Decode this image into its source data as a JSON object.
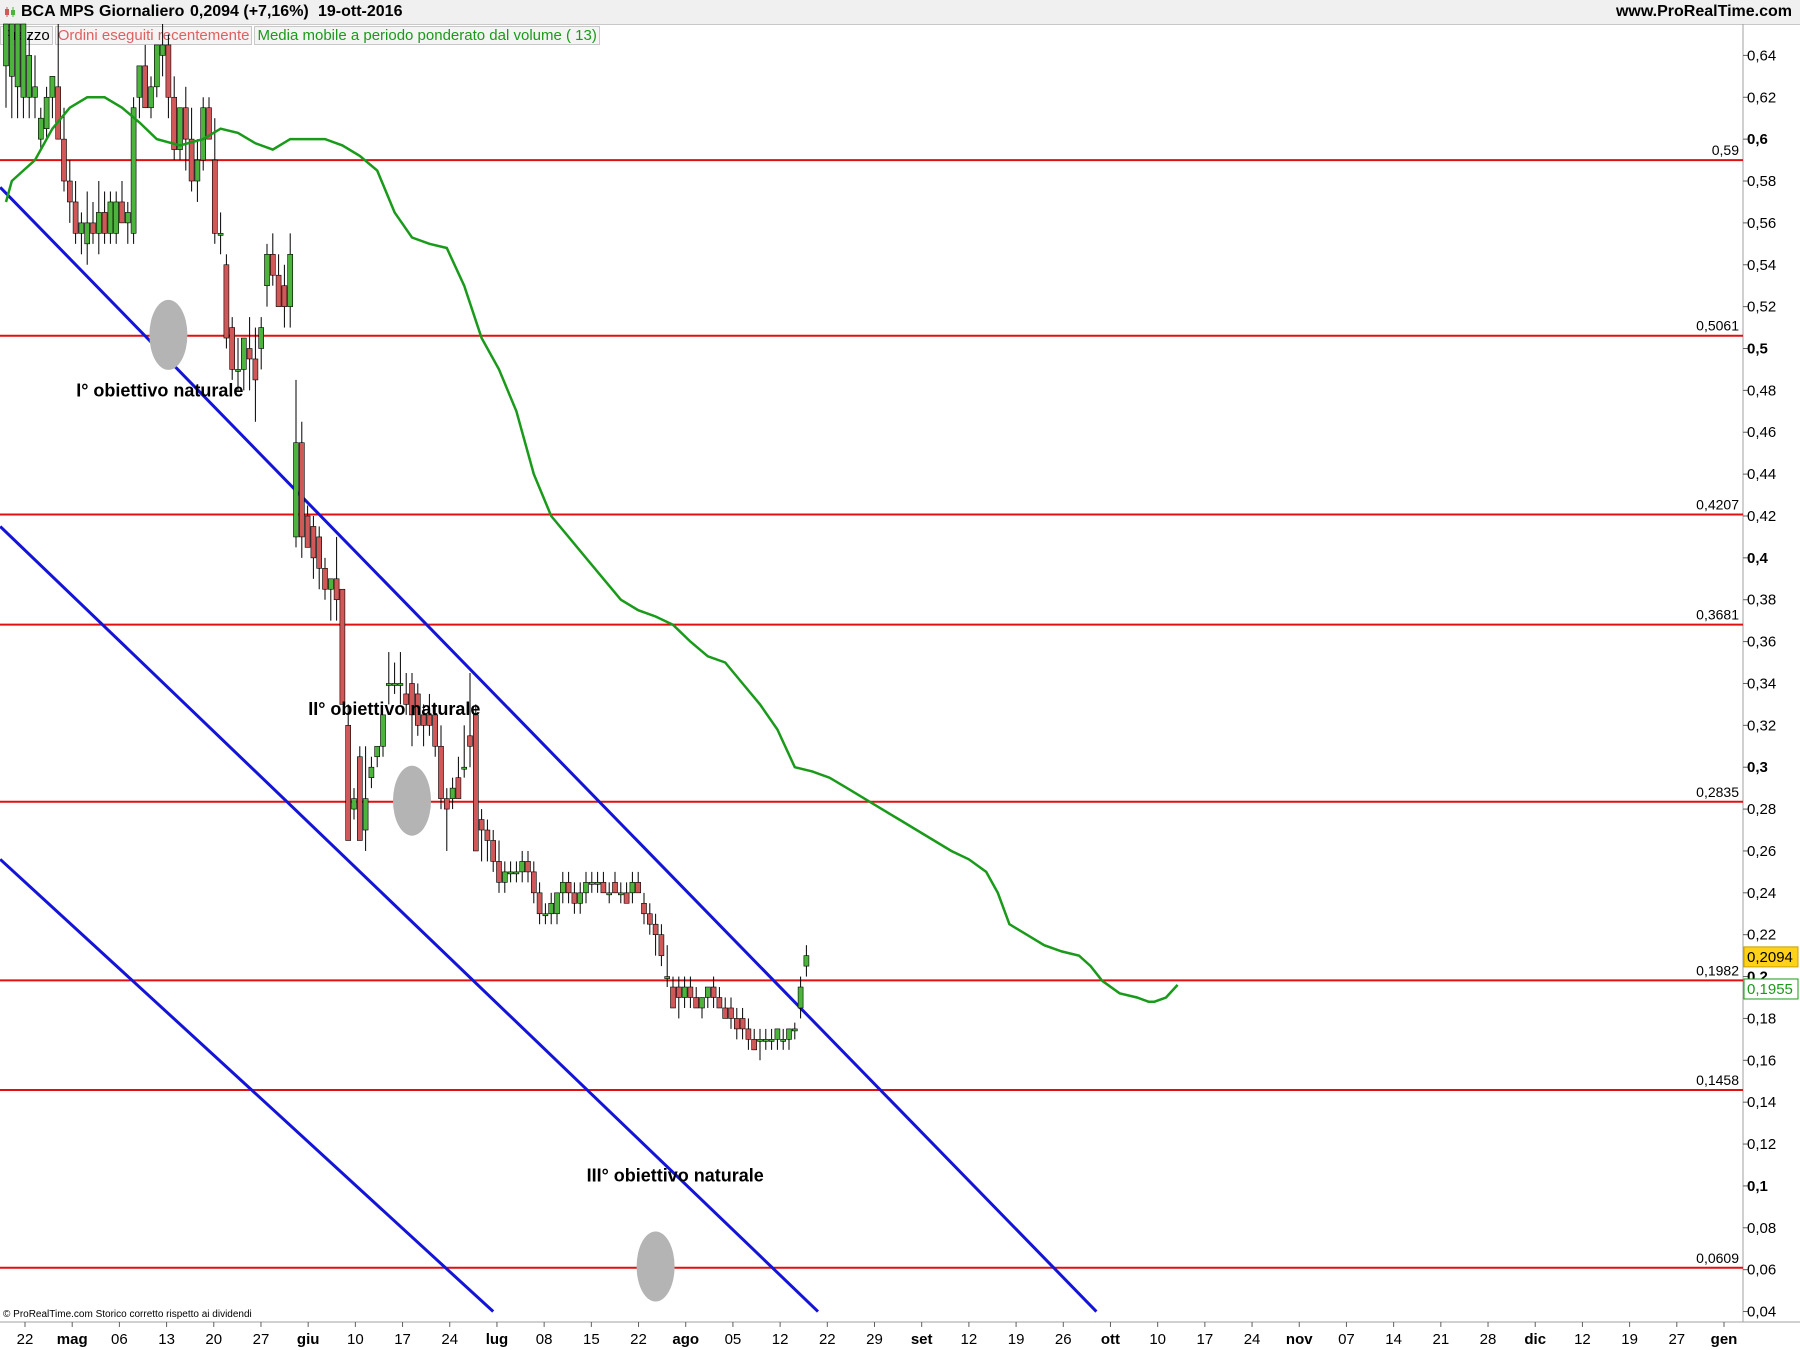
{
  "header": {
    "symbol": "BCA MPS",
    "period": "Giornaliero",
    "price": "0,2094 (+7,16%)",
    "date": "19-ott-2016",
    "site": "www.ProRealTime.com"
  },
  "legend": {
    "price_label": "Prezzo",
    "orders_label": "Ordini eseguiti recentemente",
    "ma_label": "Media mobile a periodo ponderato dal volume ( 13)"
  },
  "footer": "© ProRealTime.com  Storico corretto rispetto ai dividendi",
  "colors": {
    "up": "#4cb43c",
    "down": "#d05858",
    "ma": "#1a9a1a",
    "trend": "#1414d8",
    "level": "#e01010",
    "orders_text": "#e06060"
  },
  "chart_data": {
    "type": "candlestick",
    "ylim": [
      0.035,
      0.655
    ],
    "y_ticks": [
      "0,64",
      "0,62",
      "0,6",
      "0,58",
      "0,56",
      "0,54",
      "0,52",
      "0,5",
      "0,48",
      "0,46",
      "0,44",
      "0,42",
      "0,4",
      "0,38",
      "0,36",
      "0,34",
      "0,32",
      "0,3",
      "0,28",
      "0,26",
      "0,24",
      "0,22",
      "0,2",
      "0,18",
      "0,16",
      "0,14",
      "0,12",
      "0,1",
      "0,08",
      "0,06",
      "0,04"
    ],
    "x_labels": [
      "22",
      "mag",
      "06",
      "13",
      "20",
      "27",
      "giu",
      "10",
      "17",
      "24",
      "lug",
      "08",
      "15",
      "22",
      "ago",
      "05",
      "12",
      "22",
      "29",
      "set",
      "12",
      "19",
      "26",
      "ott",
      "10",
      "17",
      "24",
      "nov",
      "07",
      "14",
      "21",
      "28",
      "dic",
      "12",
      "19",
      "27",
      "gen"
    ],
    "horizontal_levels": [
      {
        "value": 0.59,
        "label": "0,59"
      },
      {
        "value": 0.5061,
        "label": "0,5061"
      },
      {
        "value": 0.4207,
        "label": "0,4207"
      },
      {
        "value": 0.3681,
        "label": "0,3681"
      },
      {
        "value": 0.2835,
        "label": "0,2835"
      },
      {
        "value": 0.1982,
        "label": "0,1982"
      },
      {
        "value": 0.1458,
        "label": "0,1458"
      },
      {
        "value": 0.0609,
        "label": "0,0609"
      }
    ],
    "last_price": {
      "value": 0.2094,
      "label": "0,2094"
    },
    "ma_value": {
      "value": 0.1955,
      "label": "0,1955"
    },
    "annotations": [
      {
        "text": "I° obiettivo naturale",
        "day": 19,
        "value": 0.477
      },
      {
        "text": "II° obiettivo naturale",
        "day": 59,
        "value": 0.325
      },
      {
        "text": "III° obiettivo naturale",
        "day": 107,
        "value": 0.102
      }
    ],
    "ovals": [
      {
        "day": 28,
        "value": 0.5065
      },
      {
        "day": 70,
        "value": 0.284
      },
      {
        "day": 112,
        "value": 0.0615
      }
    ],
    "trendlines": [
      {
        "from": [
          -1,
          0.577
        ],
        "to": [
          188,
          0.04
        ]
      },
      {
        "from": [
          -1,
          0.415
        ],
        "to": [
          140,
          0.04
        ]
      },
      {
        "from": [
          -1,
          0.256
        ],
        "to": [
          84,
          0.04
        ]
      }
    ],
    "candles": [
      [
        0.635,
        0.655,
        0.615,
        0.655
      ],
      [
        0.63,
        0.655,
        0.61,
        0.655
      ],
      [
        0.625,
        0.655,
        0.61,
        0.655
      ],
      [
        0.62,
        0.655,
        0.61,
        0.655
      ],
      [
        0.62,
        0.65,
        0.61,
        0.64
      ],
      [
        0.62,
        0.64,
        0.61,
        0.625
      ],
      [
        0.6,
        0.615,
        0.595,
        0.61
      ],
      [
        0.605,
        0.625,
        0.6,
        0.62
      ],
      [
        0.62,
        0.63,
        0.61,
        0.63
      ],
      [
        0.625,
        0.655,
        0.6,
        0.6
      ],
      [
        0.6,
        0.615,
        0.575,
        0.58
      ],
      [
        0.58,
        0.59,
        0.56,
        0.57
      ],
      [
        0.57,
        0.58,
        0.55,
        0.555
      ],
      [
        0.555,
        0.565,
        0.545,
        0.56
      ],
      [
        0.55,
        0.575,
        0.54,
        0.56
      ],
      [
        0.56,
        0.57,
        0.55,
        0.555
      ],
      [
        0.555,
        0.58,
        0.545,
        0.565
      ],
      [
        0.565,
        0.575,
        0.55,
        0.555
      ],
      [
        0.555,
        0.575,
        0.55,
        0.57
      ],
      [
        0.555,
        0.575,
        0.55,
        0.57
      ],
      [
        0.57,
        0.58,
        0.56,
        0.56
      ],
      [
        0.56,
        0.57,
        0.55,
        0.565
      ],
      [
        0.555,
        0.62,
        0.55,
        0.615
      ],
      [
        0.62,
        0.63,
        0.61,
        0.635
      ],
      [
        0.635,
        0.645,
        0.615,
        0.615
      ],
      [
        0.615,
        0.63,
        0.61,
        0.625
      ],
      [
        0.625,
        0.64,
        0.62,
        0.645
      ],
      [
        0.64,
        0.655,
        0.63,
        0.645
      ],
      [
        0.645,
        0.65,
        0.61,
        0.62
      ],
      [
        0.62,
        0.63,
        0.59,
        0.595
      ],
      [
        0.595,
        0.61,
        0.59,
        0.615
      ],
      [
        0.615,
        0.625,
        0.585,
        0.6
      ],
      [
        0.6,
        0.615,
        0.575,
        0.58
      ],
      [
        0.58,
        0.6,
        0.57,
        0.59
      ],
      [
        0.59,
        0.62,
        0.585,
        0.615
      ],
      [
        0.615,
        0.62,
        0.6,
        0.6
      ],
      [
        0.59,
        0.61,
        0.55,
        0.555
      ],
      [
        0.555,
        0.565,
        0.545,
        0.555
      ],
      [
        0.54,
        0.545,
        0.5,
        0.505
      ],
      [
        0.51,
        0.515,
        0.485,
        0.49
      ],
      [
        0.49,
        0.505,
        0.48,
        0.49
      ],
      [
        0.49,
        0.505,
        0.48,
        0.505
      ],
      [
        0.5,
        0.515,
        0.48,
        0.495
      ],
      [
        0.495,
        0.51,
        0.465,
        0.485
      ],
      [
        0.5,
        0.515,
        0.49,
        0.51
      ],
      [
        0.53,
        0.55,
        0.52,
        0.545
      ],
      [
        0.545,
        0.555,
        0.53,
        0.535
      ],
      [
        0.535,
        0.545,
        0.52,
        0.52
      ],
      [
        0.53,
        0.54,
        0.51,
        0.52
      ],
      [
        0.52,
        0.555,
        0.51,
        0.545
      ],
      [
        0.41,
        0.485,
        0.405,
        0.455
      ],
      [
        0.455,
        0.465,
        0.4,
        0.41
      ],
      [
        0.42,
        0.425,
        0.405,
        0.405
      ],
      [
        0.415,
        0.42,
        0.39,
        0.4
      ],
      [
        0.41,
        0.415,
        0.385,
        0.395
      ],
      [
        0.395,
        0.4,
        0.38,
        0.385
      ],
      [
        0.385,
        0.39,
        0.37,
        0.39
      ],
      [
        0.39,
        0.41,
        0.37,
        0.38
      ],
      [
        0.385,
        0.385,
        0.33,
        0.33
      ],
      [
        0.32,
        0.33,
        0.28,
        0.265
      ],
      [
        0.28,
        0.29,
        0.275,
        0.285
      ],
      [
        0.305,
        0.31,
        0.265,
        0.265
      ],
      [
        0.27,
        0.31,
        0.26,
        0.285
      ],
      [
        0.295,
        0.305,
        0.29,
        0.3
      ],
      [
        0.305,
        0.31,
        0.3,
        0.31
      ],
      [
        0.31,
        0.325,
        0.305,
        0.325
      ],
      [
        0.34,
        0.355,
        0.33,
        0.34
      ],
      [
        0.34,
        0.35,
        0.335,
        0.34
      ],
      [
        0.34,
        0.355,
        0.33,
        0.34
      ],
      [
        0.335,
        0.345,
        0.325,
        0.33
      ],
      [
        0.34,
        0.345,
        0.31,
        0.325
      ],
      [
        0.335,
        0.34,
        0.315,
        0.32
      ],
      [
        0.325,
        0.33,
        0.31,
        0.32
      ],
      [
        0.325,
        0.335,
        0.315,
        0.32
      ],
      [
        0.325,
        0.33,
        0.305,
        0.31
      ],
      [
        0.31,
        0.32,
        0.28,
        0.285
      ],
      [
        0.285,
        0.29,
        0.26,
        0.28
      ],
      [
        0.285,
        0.295,
        0.28,
        0.29
      ],
      [
        0.295,
        0.305,
        0.285,
        0.285
      ],
      [
        0.3,
        0.32,
        0.295,
        0.3
      ],
      [
        0.315,
        0.345,
        0.3,
        0.31
      ],
      [
        0.325,
        0.33,
        0.26,
        0.26
      ],
      [
        0.275,
        0.28,
        0.255,
        0.27
      ],
      [
        0.27,
        0.275,
        0.255,
        0.265
      ],
      [
        0.265,
        0.27,
        0.25,
        0.255
      ],
      [
        0.255,
        0.265,
        0.24,
        0.245
      ],
      [
        0.245,
        0.255,
        0.24,
        0.25
      ],
      [
        0.25,
        0.255,
        0.245,
        0.25
      ],
      [
        0.25,
        0.255,
        0.245,
        0.25
      ],
      [
        0.25,
        0.26,
        0.245,
        0.255
      ],
      [
        0.255,
        0.26,
        0.245,
        0.25
      ],
      [
        0.25,
        0.255,
        0.235,
        0.24
      ],
      [
        0.24,
        0.245,
        0.225,
        0.23
      ],
      [
        0.23,
        0.235,
        0.225,
        0.23
      ],
      [
        0.23,
        0.24,
        0.225,
        0.235
      ],
      [
        0.23,
        0.24,
        0.225,
        0.24
      ],
      [
        0.24,
        0.25,
        0.235,
        0.245
      ],
      [
        0.245,
        0.25,
        0.235,
        0.24
      ],
      [
        0.24,
        0.245,
        0.23,
        0.235
      ],
      [
        0.235,
        0.245,
        0.23,
        0.24
      ],
      [
        0.24,
        0.25,
        0.235,
        0.245
      ],
      [
        0.245,
        0.25,
        0.24,
        0.245
      ],
      [
        0.245,
        0.25,
        0.24,
        0.245
      ],
      [
        0.245,
        0.25,
        0.24,
        0.24
      ],
      [
        0.24,
        0.245,
        0.235,
        0.24
      ],
      [
        0.245,
        0.25,
        0.24,
        0.24
      ],
      [
        0.24,
        0.245,
        0.235,
        0.24
      ],
      [
        0.24,
        0.245,
        0.235,
        0.235
      ],
      [
        0.24,
        0.25,
        0.235,
        0.245
      ],
      [
        0.245,
        0.25,
        0.24,
        0.24
      ],
      [
        0.235,
        0.24,
        0.225,
        0.23
      ],
      [
        0.23,
        0.235,
        0.22,
        0.225
      ],
      [
        0.225,
        0.23,
        0.21,
        0.22
      ],
      [
        0.22,
        0.225,
        0.205,
        0.21
      ],
      [
        0.2,
        0.215,
        0.195,
        0.2
      ],
      [
        0.195,
        0.2,
        0.185,
        0.185
      ],
      [
        0.195,
        0.2,
        0.18,
        0.19
      ],
      [
        0.19,
        0.2,
        0.185,
        0.195
      ],
      [
        0.195,
        0.2,
        0.185,
        0.19
      ],
      [
        0.19,
        0.195,
        0.185,
        0.185
      ],
      [
        0.185,
        0.19,
        0.18,
        0.19
      ],
      [
        0.19,
        0.195,
        0.185,
        0.195
      ],
      [
        0.195,
        0.2,
        0.185,
        0.19
      ],
      [
        0.19,
        0.195,
        0.185,
        0.185
      ],
      [
        0.185,
        0.19,
        0.18,
        0.18
      ],
      [
        0.185,
        0.19,
        0.175,
        0.18
      ],
      [
        0.18,
        0.185,
        0.17,
        0.175
      ],
      [
        0.18,
        0.185,
        0.17,
        0.175
      ],
      [
        0.175,
        0.18,
        0.165,
        0.17
      ],
      [
        0.17,
        0.175,
        0.165,
        0.165
      ],
      [
        0.17,
        0.175,
        0.16,
        0.17
      ],
      [
        0.17,
        0.175,
        0.165,
        0.17
      ],
      [
        0.17,
        0.175,
        0.165,
        0.17
      ],
      [
        0.17,
        0.175,
        0.165,
        0.175
      ],
      [
        0.17,
        0.175,
        0.165,
        0.17
      ],
      [
        0.17,
        0.175,
        0.165,
        0.175
      ],
      [
        0.175,
        0.178,
        0.17,
        0.175
      ],
      [
        0.185,
        0.2,
        0.18,
        0.195
      ],
      [
        0.205,
        0.215,
        0.2,
        0.21
      ]
    ],
    "ma": [
      [
        0,
        0.57
      ],
      [
        1,
        0.58
      ],
      [
        3,
        0.585
      ],
      [
        5,
        0.59
      ],
      [
        8,
        0.605
      ],
      [
        11,
        0.615
      ],
      [
        14,
        0.62
      ],
      [
        17,
        0.62
      ],
      [
        20,
        0.615
      ],
      [
        23,
        0.608
      ],
      [
        26,
        0.6
      ],
      [
        30,
        0.597
      ],
      [
        34,
        0.6
      ],
      [
        37,
        0.605
      ],
      [
        40,
        0.603
      ],
      [
        43,
        0.598
      ],
      [
        46,
        0.595
      ],
      [
        49,
        0.6
      ],
      [
        52,
        0.6
      ],
      [
        55,
        0.6
      ],
      [
        58,
        0.597
      ],
      [
        61,
        0.592
      ],
      [
        64,
        0.585
      ],
      [
        67,
        0.565
      ],
      [
        70,
        0.553
      ],
      [
        73,
        0.55
      ],
      [
        76,
        0.548
      ],
      [
        79,
        0.53
      ],
      [
        82,
        0.505
      ],
      [
        85,
        0.49
      ],
      [
        88,
        0.47
      ],
      [
        91,
        0.44
      ],
      [
        94,
        0.42
      ],
      [
        97,
        0.41
      ],
      [
        100,
        0.4
      ],
      [
        103,
        0.39
      ],
      [
        106,
        0.38
      ],
      [
        109,
        0.375
      ],
      [
        112,
        0.372
      ],
      [
        115,
        0.368
      ],
      [
        118,
        0.36
      ],
      [
        121,
        0.353
      ],
      [
        124,
        0.35
      ],
      [
        127,
        0.34
      ],
      [
        130,
        0.33
      ],
      [
        133,
        0.318
      ],
      [
        136,
        0.3
      ],
      [
        139,
        0.298
      ],
      [
        142,
        0.295
      ],
      [
        145,
        0.29
      ],
      [
        148,
        0.285
      ],
      [
        151,
        0.28
      ],
      [
        154,
        0.275
      ],
      [
        157,
        0.27
      ],
      [
        160,
        0.265
      ],
      [
        163,
        0.26
      ],
      [
        166,
        0.256
      ],
      [
        169,
        0.25
      ],
      [
        171,
        0.24
      ],
      [
        173,
        0.225
      ],
      [
        176,
        0.22
      ],
      [
        179,
        0.215
      ],
      [
        182,
        0.212
      ],
      [
        185,
        0.21
      ],
      [
        187,
        0.205
      ],
      [
        189,
        0.198
      ],
      [
        192,
        0.192
      ],
      [
        195,
        0.19
      ],
      [
        197,
        0.188
      ],
      [
        198,
        0.188
      ],
      [
        200,
        0.19
      ],
      [
        202,
        0.196
      ]
    ]
  }
}
